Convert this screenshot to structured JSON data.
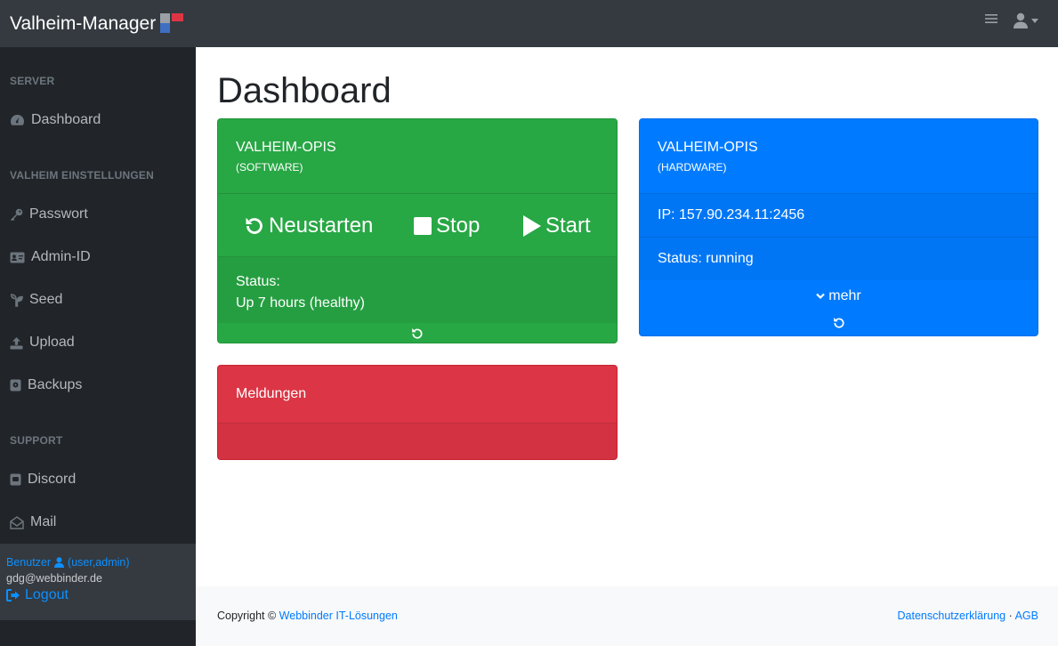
{
  "app": {
    "title": "Valheim-Manager"
  },
  "sidebar": {
    "section_server": "SERVER",
    "section_valheim": "VALHEIM EINSTELLUNGEN",
    "section_support": "SUPPORT",
    "items": {
      "dashboard": "Dashboard",
      "passwort": "Passwort",
      "admin_id": "Admin-ID",
      "seed": "Seed",
      "upload": "Upload",
      "backups": "Backups",
      "discord": "Discord",
      "mail": "Mail"
    },
    "user": {
      "label": "Benutzer",
      "roles": "(user,admin)",
      "email": "gdg@webbinder.de",
      "logout": "Logout"
    }
  },
  "main": {
    "title": "Dashboard",
    "software_card": {
      "name": "VALHEIM-OPIS",
      "subtitle": "(SOFTWARE)",
      "restart": "Neustarten",
      "stop": "Stop",
      "start": "Start",
      "status_label": "Status:",
      "status_value": "Up 7 hours (healthy)"
    },
    "hardware_card": {
      "name": "VALHEIM-OPIS",
      "subtitle": "(HARDWARE)",
      "ip": "IP: 157.90.234.11:2456",
      "status": "Status: running",
      "more": "mehr"
    },
    "messages_card": {
      "title": "Meldungen"
    }
  },
  "footer": {
    "copyright": "Copyright ©",
    "company": "Webbinder IT-Lösungen",
    "privacy": "Datenschutzerklärung",
    "separator": "·",
    "terms": "AGB"
  },
  "colors": {
    "success": "#28a745",
    "primary": "#007bff",
    "danger": "#dc3545",
    "sidebar_bg": "#212529",
    "topbar_bg": "#343a40"
  }
}
